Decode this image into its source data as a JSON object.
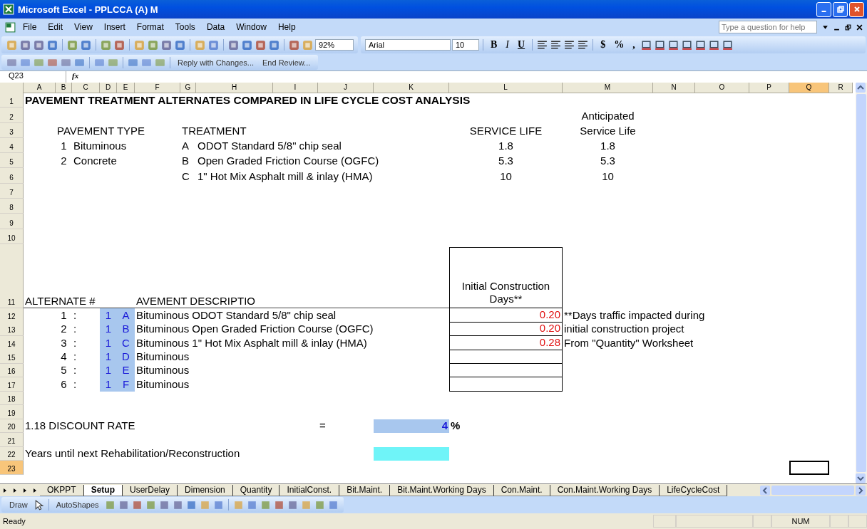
{
  "window": {
    "title": "Microsoft Excel - PPLCCA (A) M"
  },
  "menu": [
    "File",
    "Edit",
    "View",
    "Insert",
    "Format",
    "Tools",
    "Data",
    "Window",
    "Help"
  ],
  "help_box": {
    "placeholder": "Type a question for help"
  },
  "toolbar": {
    "zoom": "92%",
    "font": "Arial",
    "size": "10",
    "bold": "B",
    "italic": "I",
    "underline": "U",
    "currency": "$",
    "percent": "%",
    "comma": ","
  },
  "review_toolbar": {
    "reply": "Reply with Changes...",
    "end": "End Review..."
  },
  "formula_bar": {
    "name_box": "Q23",
    "fx": "fx"
  },
  "columns": [
    {
      "label": "A",
      "selected": false
    },
    {
      "label": "B",
      "selected": false
    },
    {
      "label": "C",
      "selected": false
    },
    {
      "label": "D",
      "selected": false
    },
    {
      "label": "E",
      "selected": false
    },
    {
      "label": "F",
      "selected": false
    },
    {
      "label": "G",
      "selected": false
    },
    {
      "label": "H",
      "selected": false
    },
    {
      "label": "I",
      "selected": false
    },
    {
      "label": "J",
      "selected": false
    },
    {
      "label": "K",
      "selected": false
    },
    {
      "label": "L",
      "selected": false
    },
    {
      "label": "M",
      "selected": false
    },
    {
      "label": "N",
      "selected": false
    },
    {
      "label": "O",
      "selected": false
    },
    {
      "label": "P",
      "selected": false
    },
    {
      "label": "Q",
      "selected": true
    },
    {
      "label": "R",
      "selected": false
    }
  ],
  "rows": [
    {
      "number": "1",
      "selected": false,
      "cells": {
        "A": {
          "kind": "title",
          "text": "PAVEMENT TREATMENT ALTERNATES COMPARED IN LIFE CYCLE COST ANALYSIS"
        }
      }
    },
    {
      "number": "2",
      "selected": false,
      "cells": {
        "M": {
          "kind": "center",
          "text": "Anticipated"
        }
      }
    },
    {
      "number": "3",
      "selected": false,
      "cells": {
        "B": {
          "kind": "text",
          "text": "PAVEMENT TYPE"
        },
        "G": {
          "kind": "text",
          "text": "TREATMENT"
        },
        "L": {
          "kind": "center",
          "text": "SERVICE LIFE"
        },
        "M": {
          "kind": "center",
          "text": "Service Life"
        }
      }
    },
    {
      "number": "4",
      "selected": false,
      "cells": {
        "B": {
          "kind": "center",
          "text": "1"
        },
        "C": {
          "kind": "text",
          "text": "Bituminous"
        },
        "G": {
          "kind": "text",
          "text": "A"
        },
        "H": {
          "kind": "text",
          "text": "ODOT Standard 5/8\" chip seal"
        },
        "L": {
          "kind": "center",
          "text": "1.8"
        },
        "M": {
          "kind": "center",
          "text": "1.8"
        }
      }
    },
    {
      "number": "5",
      "selected": false,
      "cells": {
        "B": {
          "kind": "center",
          "text": "2"
        },
        "C": {
          "kind": "text",
          "text": "Concrete"
        },
        "G": {
          "kind": "text",
          "text": "B"
        },
        "H": {
          "kind": "text",
          "text": "Open Graded Friction Course (OGFC)"
        },
        "L": {
          "kind": "center",
          "text": "5.3"
        },
        "M": {
          "kind": "center",
          "text": "5.3"
        }
      }
    },
    {
      "number": "6",
      "selected": false,
      "cells": {
        "G": {
          "kind": "text",
          "text": "C"
        },
        "H": {
          "kind": "text",
          "text": "1\" Hot Mix Asphalt mill & inlay (HMA)"
        },
        "L": {
          "kind": "center",
          "text": "10"
        },
        "M": {
          "kind": "center",
          "text": "10"
        }
      }
    },
    {
      "number": "7",
      "selected": false,
      "cells": {}
    },
    {
      "number": "8",
      "selected": false,
      "cells": {}
    },
    {
      "number": "9",
      "selected": false,
      "cells": {}
    },
    {
      "number": "10",
      "selected": false,
      "cells": {}
    },
    {
      "number": "11",
      "selected": false,
      "rule": true,
      "cells": {
        "A": {
          "kind": "text",
          "text": "ALTERNATE #"
        },
        "F": {
          "kind": "text",
          "text": "AVEMENT DESCRIPTIO"
        },
        "L": {
          "kind": "box-head",
          "text": "Initial Construction Days**"
        }
      }
    },
    {
      "number": "12",
      "selected": false,
      "cells": {
        "B": {
          "kind": "center",
          "text": "1"
        },
        "C": {
          "kind": "text",
          "text": ":"
        },
        "D": {
          "kind": "input",
          "text": "1"
        },
        "E": {
          "kind": "input",
          "text": "A"
        },
        "F": {
          "kind": "text",
          "text": "Bituminous ODOT Standard 5/8\" chip seal"
        },
        "L": {
          "kind": "days",
          "text": "0.20"
        },
        "M": {
          "kind": "text",
          "text": "**Days traffic impacted during"
        }
      }
    },
    {
      "number": "13",
      "selected": false,
      "cells": {
        "B": {
          "kind": "center",
          "text": "2"
        },
        "C": {
          "kind": "text",
          "text": ":"
        },
        "D": {
          "kind": "input",
          "text": "1"
        },
        "E": {
          "kind": "input",
          "text": "B"
        },
        "F": {
          "kind": "text",
          "text": "Bituminous Open Graded Friction Course (OGFC)"
        },
        "L": {
          "kind": "days",
          "text": "0.20"
        },
        "M": {
          "kind": "text",
          "text": "initial  construction project"
        }
      }
    },
    {
      "number": "14",
      "selected": false,
      "cells": {
        "B": {
          "kind": "center",
          "text": "3"
        },
        "C": {
          "kind": "text",
          "text": ":"
        },
        "D": {
          "kind": "input",
          "text": "1"
        },
        "E": {
          "kind": "input",
          "text": "C"
        },
        "F": {
          "kind": "text",
          "text": "Bituminous 1\" Hot Mix Asphalt mill & inlay (HMA)"
        },
        "L": {
          "kind": "days",
          "text": "0.28"
        },
        "M": {
          "kind": "text",
          "text": "From \"Quantity\" Worksheet"
        }
      }
    },
    {
      "number": "15",
      "selected": false,
      "cells": {
        "B": {
          "kind": "center",
          "text": "4"
        },
        "C": {
          "kind": "text",
          "text": ":"
        },
        "D": {
          "kind": "input",
          "text": "1"
        },
        "E": {
          "kind": "input",
          "text": "D"
        },
        "F": {
          "kind": "text",
          "text": "Bituminous"
        },
        "L": {
          "kind": "box"
        }
      }
    },
    {
      "number": "16",
      "selected": false,
      "cells": {
        "B": {
          "kind": "center",
          "text": "5"
        },
        "C": {
          "kind": "text",
          "text": ":"
        },
        "D": {
          "kind": "input",
          "text": "1"
        },
        "E": {
          "kind": "input",
          "text": "E"
        },
        "F": {
          "kind": "text",
          "text": "Bituminous"
        },
        "L": {
          "kind": "box"
        }
      }
    },
    {
      "number": "17",
      "selected": false,
      "cells": {
        "B": {
          "kind": "center",
          "text": "6"
        },
        "C": {
          "kind": "text",
          "text": ":"
        },
        "D": {
          "kind": "input",
          "text": "1"
        },
        "E": {
          "kind": "input",
          "text": "F"
        },
        "F": {
          "kind": "text",
          "text": "Bituminous"
        },
        "L": {
          "kind": "box"
        }
      }
    },
    {
      "number": "18",
      "selected": false,
      "cells": {}
    },
    {
      "number": "19",
      "selected": false,
      "cells": {}
    },
    {
      "number": "20",
      "selected": false,
      "cells": {
        "A": {
          "kind": "text",
          "text": "1.18  DISCOUNT RATE"
        },
        "J": {
          "kind": "text",
          "text": "="
        },
        "K": {
          "kind": "rate",
          "text": "4"
        },
        "L": {
          "kind": "unit",
          "text": "%"
        }
      }
    },
    {
      "number": "21",
      "selected": false,
      "cells": {}
    },
    {
      "number": "22",
      "selected": false,
      "cells": {
        "A": {
          "kind": "text",
          "text": "Years until next Rehabilitation/Reconstruction"
        },
        "K": {
          "kind": "cyan"
        }
      }
    },
    {
      "number": "23",
      "selected": true,
      "cells": {}
    }
  ],
  "sheet_tabs": [
    {
      "label": "OKPPT",
      "selected": false
    },
    {
      "label": "Setup",
      "selected": true
    },
    {
      "label": "UserDelay",
      "selected": false
    },
    {
      "label": "Dimension",
      "selected": false
    },
    {
      "label": "Quantity",
      "selected": false
    },
    {
      "label": "InitialConst.",
      "selected": false
    },
    {
      "label": "Bit.Maint.",
      "selected": false
    },
    {
      "label": "Bit.Maint.Working Days",
      "selected": false
    },
    {
      "label": "Con.Maint.",
      "selected": false
    },
    {
      "label": "Con.Maint.Working Days",
      "selected": false
    },
    {
      "label": "LifeCycleCost",
      "selected": false
    }
  ],
  "drawing_toolbar": {
    "draw": "Draw",
    "autoshapes": "AutoShapes"
  },
  "status_bar": {
    "text": "Ready",
    "num": "NUM"
  }
}
